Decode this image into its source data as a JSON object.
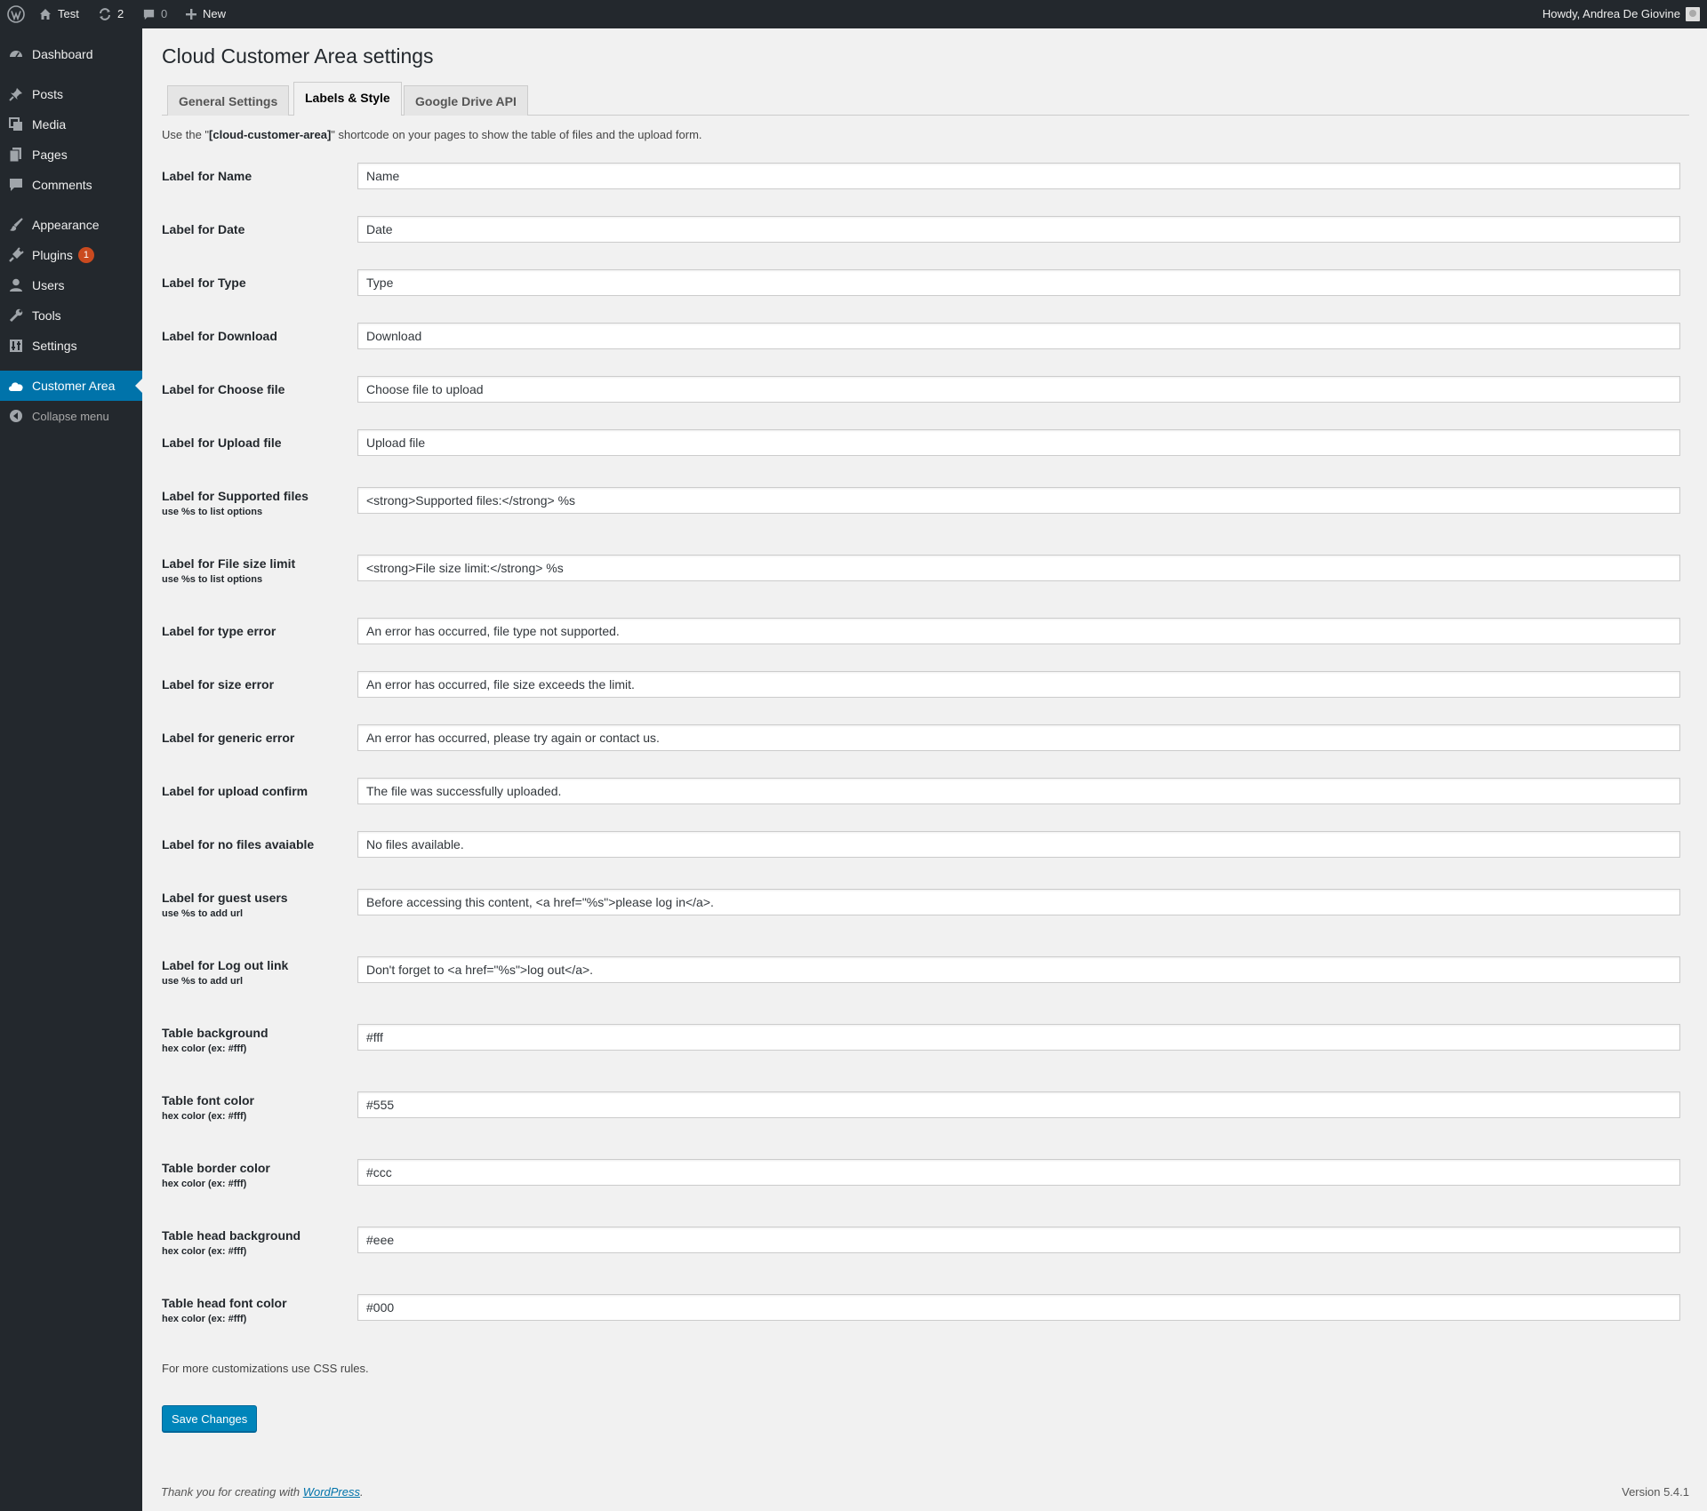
{
  "adminbar": {
    "site_name": "Test",
    "updates_count": "2",
    "comments_count": "0",
    "new_label": "New",
    "greeting": "Howdy, Andrea De Giovine"
  },
  "sidebar": {
    "items": [
      {
        "label": "Dashboard",
        "icon": "dashboard-icon"
      },
      {
        "label": "Posts",
        "icon": "pushpin-icon"
      },
      {
        "label": "Media",
        "icon": "media-icon"
      },
      {
        "label": "Pages",
        "icon": "pages-icon"
      },
      {
        "label": "Comments",
        "icon": "comment-icon"
      },
      {
        "label": "Appearance",
        "icon": "brush-icon"
      },
      {
        "label": "Plugins",
        "icon": "plug-icon",
        "badge": "1"
      },
      {
        "label": "Users",
        "icon": "user-icon"
      },
      {
        "label": "Tools",
        "icon": "wrench-icon"
      },
      {
        "label": "Settings",
        "icon": "settings-icon"
      },
      {
        "label": "Customer Area",
        "icon": "cloud-icon",
        "current": true
      },
      {
        "label": "Collapse menu",
        "icon": "collapse-icon"
      }
    ]
  },
  "page": {
    "title": "Cloud Customer Area settings",
    "tabs": [
      {
        "label": "General Settings",
        "active": false
      },
      {
        "label": "Labels & Style",
        "active": true
      },
      {
        "label": "Google Drive API",
        "active": false
      }
    ],
    "intro_before": "Use the \"",
    "intro_code": "[cloud-customer-area]",
    "intro_after": "\" shortcode on your pages to show the table of files and the upload form.",
    "fields": [
      {
        "label": "Label for Name",
        "hint": "",
        "value": "Name"
      },
      {
        "label": "Label for Date",
        "hint": "",
        "value": "Date"
      },
      {
        "label": "Label for Type",
        "hint": "",
        "value": "Type"
      },
      {
        "label": "Label for Download",
        "hint": "",
        "value": "Download"
      },
      {
        "label": "Label for Choose file",
        "hint": "",
        "value": "Choose file to upload"
      },
      {
        "label": "Label for Upload file",
        "hint": "",
        "value": "Upload file"
      },
      {
        "label": "Label for Supported files",
        "hint": "use %s to list options",
        "value": "<strong>Supported files:</strong> %s"
      },
      {
        "label": "Label for File size limit",
        "hint": "use %s to list options",
        "value": "<strong>File size limit:</strong> %s"
      },
      {
        "label": "Label for type error",
        "hint": "",
        "value": "An error has occurred, file type not supported."
      },
      {
        "label": "Label for size error",
        "hint": "",
        "value": "An error has occurred, file size exceeds the limit."
      },
      {
        "label": "Label for generic error",
        "hint": "",
        "value": "An error has occurred, please try again or contact us."
      },
      {
        "label": "Label for upload confirm",
        "hint": "",
        "value": "The file was successfully uploaded."
      },
      {
        "label": "Label for no files avaiable",
        "hint": "",
        "value": "No files available."
      },
      {
        "label": "Label for guest users",
        "hint": "use %s to add url",
        "value": "Before accessing this content, <a href=\"%s\">please log in</a>."
      },
      {
        "label": "Label for Log out link",
        "hint": "use %s to add url",
        "value": "Don't forget to <a href=\"%s\">log out</a>."
      },
      {
        "label": "Table background",
        "hint": "hex color (ex: #fff)",
        "value": "#fff"
      },
      {
        "label": "Table font color",
        "hint": "hex color (ex: #fff)",
        "value": "#555"
      },
      {
        "label": "Table border color",
        "hint": "hex color (ex: #fff)",
        "value": "#ccc"
      },
      {
        "label": "Table head background",
        "hint": "hex color (ex: #fff)",
        "value": "#eee"
      },
      {
        "label": "Table head font color",
        "hint": "hex color (ex: #fff)",
        "value": "#000"
      }
    ],
    "more_note": "For more customizations use CSS rules.",
    "save_label": "Save Changes"
  },
  "footer": {
    "thanks_prefix": "Thank you for creating with ",
    "thanks_link": "WordPress",
    "thanks_suffix": ".",
    "version": "Version 5.4.1"
  },
  "colors": {
    "admin_dark": "#23282d",
    "accent": "#0073aa",
    "button": "#0085ba",
    "badge": "#ca4a1f",
    "background": "#f1f1f1"
  }
}
